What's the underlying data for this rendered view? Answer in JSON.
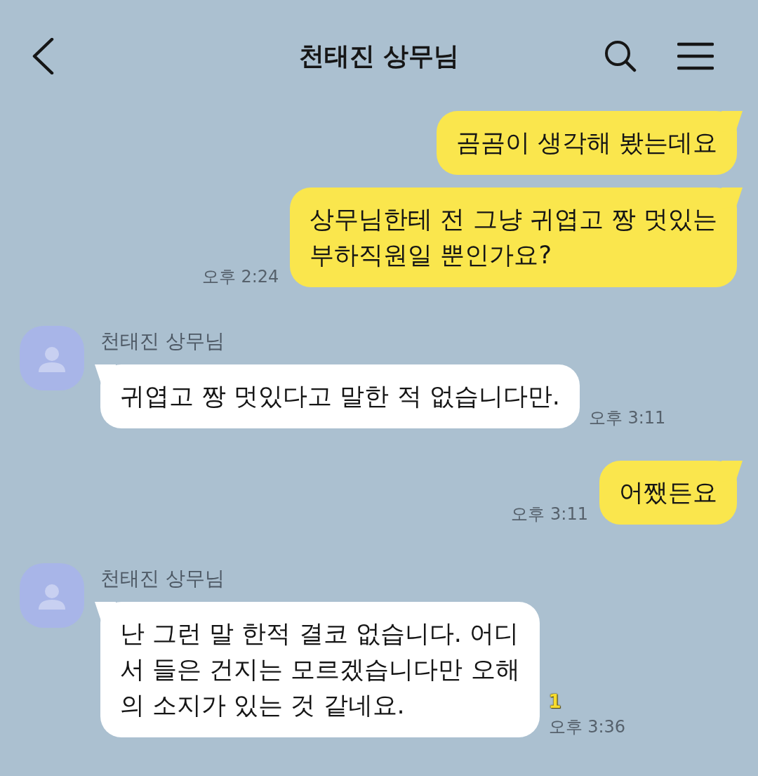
{
  "header": {
    "title": "천태진 상무님"
  },
  "messages": [
    {
      "kind": "sent",
      "bubbles": [
        "곰곰이 생각해 봤는데요",
        "상무님한테 전 그냥 귀엽고 짱 멋있는\n부하직원일 뿐인가요?"
      ],
      "time": "오후 2:24"
    },
    {
      "kind": "received",
      "sender": "천태진 상무님",
      "bubbles": [
        "귀엽고 짱 멋있다고 말한 적 없습니다만."
      ],
      "time": "오후 3:11"
    },
    {
      "kind": "sent",
      "bubbles": [
        "어쨌든요"
      ],
      "time": "오후 3:11"
    },
    {
      "kind": "received",
      "sender": "천태진 상무님",
      "bubbles": [
        "난 그런 말 한적 결코 없습니다. 어디\n서 들은 건지는 모르겠습니다만 오해\n의 소지가 있는 것 같네요."
      ],
      "unread": "1",
      "time": "오후 3:36"
    }
  ]
}
